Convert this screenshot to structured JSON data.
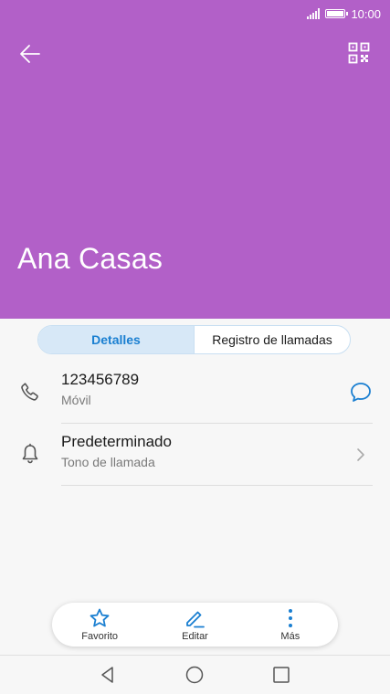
{
  "status_bar": {
    "time": "10:00"
  },
  "header": {
    "contact_name": "Ana Casas",
    "color": "#b260c8",
    "back_icon": "arrow-left-icon",
    "qr_icon": "qr-code-icon"
  },
  "tabs": [
    {
      "label": "Detalles",
      "active": true
    },
    {
      "label": "Registro de llamadas",
      "active": false
    }
  ],
  "details": [
    {
      "icon": "phone-icon",
      "primary": "123456789",
      "secondary": "Móvil",
      "action_icon": "message-icon"
    },
    {
      "icon": "bell-icon",
      "primary": "Predeterminado",
      "secondary": "Tono de llamada",
      "action_icon": "chevron-right-icon"
    }
  ],
  "bottom_actions": [
    {
      "label": "Favorito",
      "icon": "star-icon"
    },
    {
      "label": "Editar",
      "icon": "edit-icon"
    },
    {
      "label": "Más",
      "icon": "more-vertical-icon"
    }
  ],
  "colors": {
    "accent": "#1a7fd1",
    "tab_active_bg": "#d7e8f7"
  }
}
